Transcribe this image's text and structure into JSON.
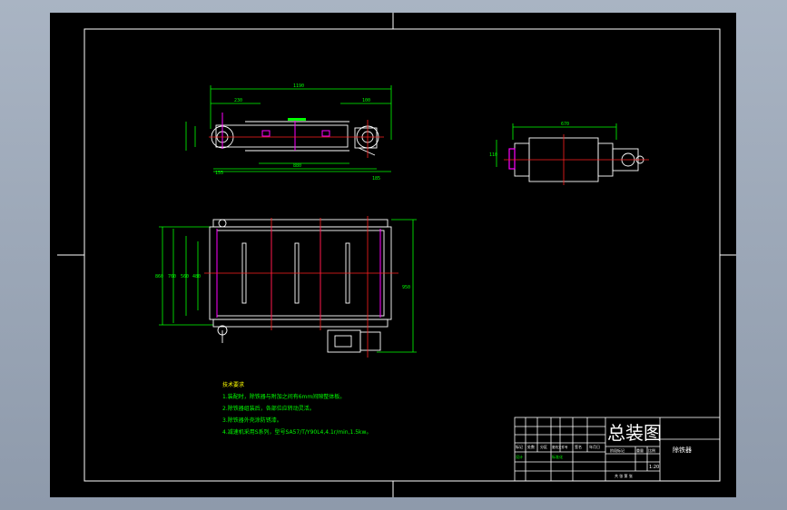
{
  "drawing": {
    "title_cn": "总装图",
    "part_name": "除铁器",
    "scale": "1:20",
    "technical_requirements": {
      "heading": "技术要求",
      "items": [
        "1.装配时，除铁器与附加之间有6mm间隙整体板。",
        "2.除铁器组装后，各部位应转动灵活。",
        "3.除铁器外壳涂防锈漆。",
        "4.减速机采用S系列，型号SA57/T/Y90L4,4.1r/min,1.5kw。"
      ]
    },
    "dimensions": {
      "top_overall": "1190",
      "top_left_offset": "230",
      "top_right_offset": "100",
      "top_bottom_span": "880",
      "top_bottom_left": "155",
      "top_bottom_right": "185",
      "side_overall": "670",
      "side_height": "110",
      "plan_w1": "860",
      "plan_w2": "760",
      "plan_w3": "560",
      "plan_w4": "480",
      "plan_right": "950"
    },
    "title_block": {
      "row_labels": [
        "标记",
        "处数",
        "分区",
        "更改文件号",
        "签名",
        "年月日"
      ],
      "designer": "设计",
      "standardize": "标准化",
      "stage_label": "阶段标记",
      "weight_label": "重量",
      "scale_label": "比例",
      "sheet_label": "共 张 第 张"
    }
  }
}
